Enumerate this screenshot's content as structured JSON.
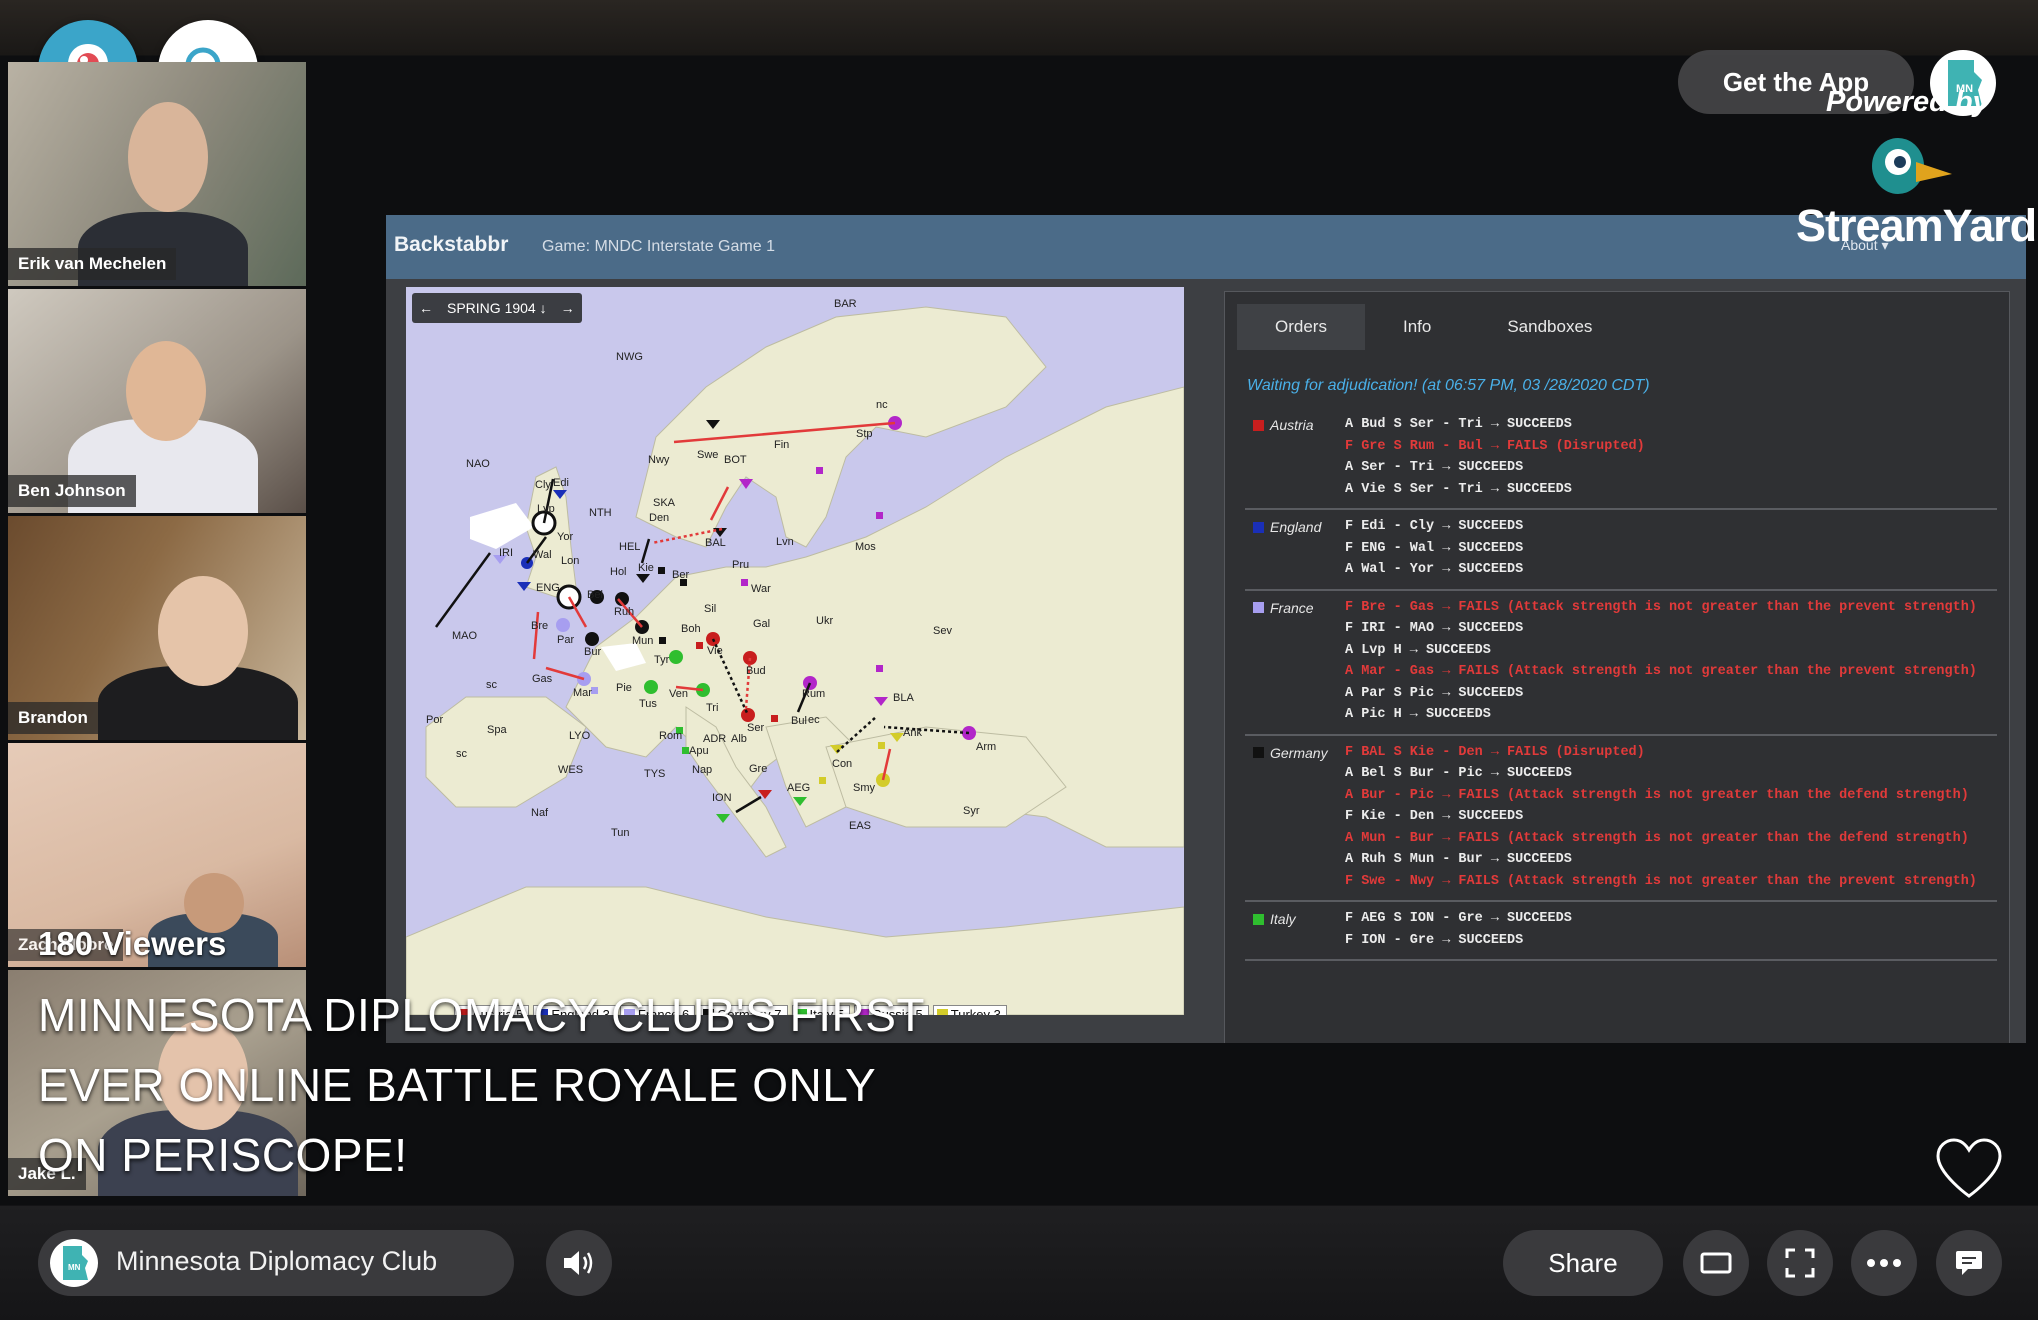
{
  "participants": [
    {
      "name": "Erik van Mechelen"
    },
    {
      "name": "Ben Johnson"
    },
    {
      "name": "Brandon"
    },
    {
      "name": "Zach Moore"
    },
    {
      "name": "Jake L."
    }
  ],
  "backstabbr": {
    "logo": "Backstabbr",
    "game": "Game: MNDC Interstate Game 1",
    "about": "About ▾",
    "season": "SPRING 1904 ↓",
    "tabs": [
      "Orders",
      "Info",
      "Sandboxes"
    ],
    "waiting": "Waiting for adjudication! (at 06:57 PM, 03 /28/2020 CDT)",
    "legend": [
      {
        "label": "Austria 5",
        "color": "#c81e1e"
      },
      {
        "label": "England 3",
        "color": "#1a2fb8"
      },
      {
        "label": "France 6",
        "color": "#a79ef0"
      },
      {
        "label": "Germany 7",
        "color": "#111111"
      },
      {
        "label": "Italy 5",
        "color": "#2fbe2f"
      },
      {
        "label": "Russia 5",
        "color": "#b226c9"
      },
      {
        "label": "Turkey 3",
        "color": "#d3cc2a"
      }
    ],
    "map_labels": [
      "BAR",
      "NWG",
      "NAO",
      "Stp",
      "Fin",
      "Nwy",
      "Swe",
      "BOT",
      "Cly",
      "Edi",
      "NTH",
      "SKA",
      "Den",
      "Lvp",
      "Yor",
      "IRI",
      "HEL",
      "BAL",
      "Lvn",
      "Mos",
      "Wal",
      "Lon",
      "Hol",
      "Kie",
      "Ber",
      "Pru",
      "ENG",
      "Bel",
      "Ruh",
      "War",
      "Sil",
      "Bre",
      "Par",
      "Bur",
      "Mun",
      "Boh",
      "Gal",
      "Ukr",
      "Sev",
      "MAO",
      "Gas",
      "Tyr",
      "Vie",
      "Bud",
      "Mar",
      "Pie",
      "Ven",
      "Tri",
      "Rum",
      "BLA",
      "Por",
      "Spa",
      "LYO",
      "Tus",
      "Rom",
      "Ser",
      "Bul",
      "Ank",
      "Arm",
      "Apu",
      "ADR",
      "Alb",
      "Con",
      "WES",
      "TYS",
      "Nap",
      "Gre",
      "Smy",
      "ION",
      "AEG",
      "Naf",
      "Tun",
      "EAS",
      "Syr",
      "nc",
      "sc",
      "ec",
      "sc"
    ],
    "orders": [
      {
        "power": "Austria",
        "color": "#c81e1e",
        "lines": [
          {
            "text": "A Bud S Ser - Tri → SUCCEEDS",
            "failed": false
          },
          {
            "text": "F Gre S Rum - Bul → FAILS (Disrupted)",
            "failed": true
          },
          {
            "text": "A Ser - Tri → SUCCEEDS",
            "failed": false
          },
          {
            "text": "A Vie S Ser - Tri → SUCCEEDS",
            "failed": false
          }
        ]
      },
      {
        "power": "England",
        "color": "#1a2fb8",
        "lines": [
          {
            "text": "F Edi - Cly → SUCCEEDS",
            "failed": false
          },
          {
            "text": "F ENG - Wal → SUCCEEDS",
            "failed": false
          },
          {
            "text": "A Wal - Yor → SUCCEEDS",
            "failed": false
          }
        ]
      },
      {
        "power": "France",
        "color": "#a79ef0",
        "lines": [
          {
            "text": "F Bre - Gas → FAILS (Attack strength is not greater than the prevent strength)",
            "failed": true
          },
          {
            "text": "F IRI - MAO → SUCCEEDS",
            "failed": false
          },
          {
            "text": "A Lvp H → SUCCEEDS",
            "failed": false
          },
          {
            "text": "A Mar - Gas → FAILS (Attack strength is not greater than the prevent strength)",
            "failed": true
          },
          {
            "text": "A Par S Pic → SUCCEEDS",
            "failed": false
          },
          {
            "text": "A Pic H → SUCCEEDS",
            "failed": false
          }
        ]
      },
      {
        "power": "Germany",
        "color": "#111111",
        "lines": [
          {
            "text": "F BAL S Kie - Den → FAILS (Disrupted)",
            "failed": true
          },
          {
            "text": "A Bel S Bur - Pic → SUCCEEDS",
            "failed": false
          },
          {
            "text": "A Bur - Pic → FAILS (Attack strength is not greater than the defend strength)",
            "failed": true
          },
          {
            "text": "F Kie - Den → SUCCEEDS",
            "failed": false
          },
          {
            "text": "A Mun - Bur → FAILS (Attack strength is not greater than the defend strength)",
            "failed": true
          },
          {
            "text": "A Ruh S Mun - Bur → SUCCEEDS",
            "failed": false
          },
          {
            "text": "F Swe - Nwy → FAILS (Attack strength is not greater than the prevent strength)",
            "failed": true
          }
        ]
      },
      {
        "power": "Italy",
        "color": "#2fbe2f",
        "lines": [
          {
            "text": "F AEG S ION - Gre → SUCCEEDS",
            "failed": false
          },
          {
            "text": "F ION - Gre → SUCCEEDS",
            "failed": false
          }
        ]
      }
    ]
  },
  "branding": {
    "get_app": "Get the App",
    "powered": "Powered by",
    "streamyard": "StreamYard",
    "mn_badge": "MN"
  },
  "overlay": {
    "viewers": "180 Viewers",
    "title": "MINNESOTA DIPLOMACY CLUB'S FIRST EVER ONLINE BATTLE ROYALE ONLY ON PERISCOPE!"
  },
  "bottom_bar": {
    "channel": "Minnesota Diplomacy Club",
    "share": "Share",
    "mn_badge": "MN"
  },
  "icons": [
    "periscope-icon",
    "search-icon",
    "volume-icon",
    "theater-mode-icon",
    "fullscreen-icon",
    "more-icon",
    "chat-icon",
    "heart-icon"
  ]
}
